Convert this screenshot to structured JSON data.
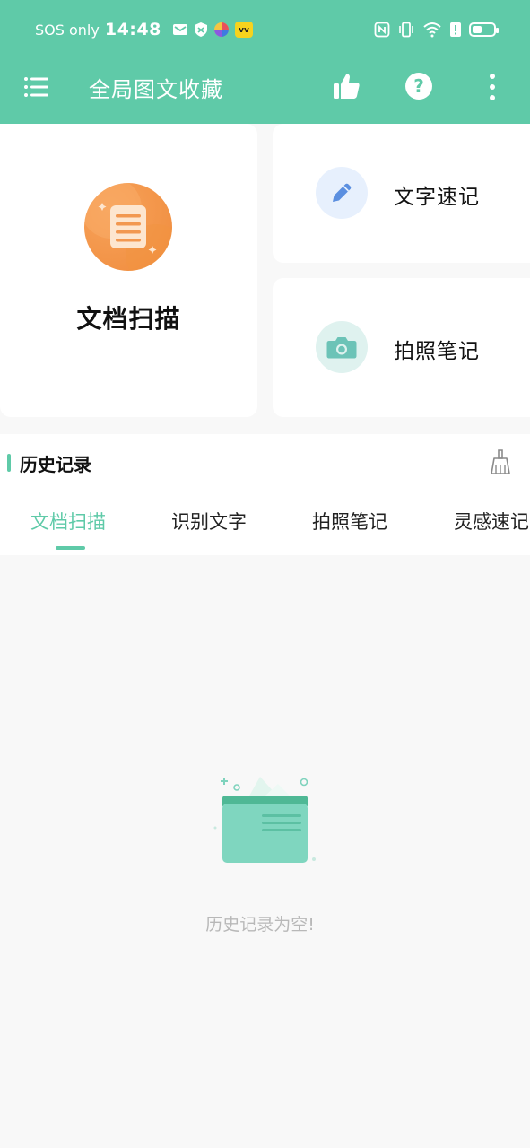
{
  "status_bar": {
    "carrier": "SOS only",
    "time": "14:48",
    "battery_level": 0.45
  },
  "app_bar": {
    "title": "全局图文收藏"
  },
  "cards": {
    "scan": {
      "label": "文档扫描"
    },
    "quick_note": {
      "label": "文字速记"
    },
    "photo_note": {
      "label": "拍照笔记"
    }
  },
  "history": {
    "title": "历史记录",
    "tabs": [
      {
        "label": "文档扫描",
        "active": true
      },
      {
        "label": "识别文字",
        "active": false
      },
      {
        "label": "拍照笔记",
        "active": false
      },
      {
        "label": "灵感速记",
        "active": false
      }
    ],
    "empty_text": "历史记录为空!"
  },
  "colors": {
    "brand": "#5fcaa8",
    "scan_icon": "#ef8b3c",
    "pencil_icon": "#5b8fe0",
    "camera_icon": "#6cc3b7"
  },
  "icons": {
    "menu": "menu-icon",
    "like": "thumbs-up-icon",
    "help": "help-icon",
    "more": "more-vertical-icon",
    "scan": "document-icon",
    "quick_note": "pencil-icon",
    "photo_note": "camera-icon",
    "clear": "broom-icon",
    "empty": "empty-folder-icon"
  }
}
